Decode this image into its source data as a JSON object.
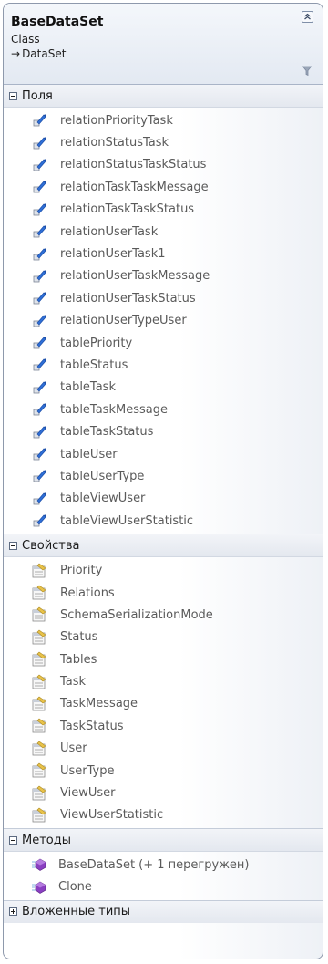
{
  "header": {
    "class_name": "BaseDataSet",
    "kind": "Class",
    "base_arrow": "→",
    "base_class": "DataSet"
  },
  "sections": {
    "fields": {
      "label": "Поля",
      "items": [
        {
          "label": "relationPriorityTask",
          "icon": "field-icon"
        },
        {
          "label": "relationStatusTask",
          "icon": "field-icon"
        },
        {
          "label": "relationStatusTaskStatus",
          "icon": "field-icon"
        },
        {
          "label": "relationTaskTaskMessage",
          "icon": "field-icon"
        },
        {
          "label": "relationTaskTaskStatus",
          "icon": "field-icon"
        },
        {
          "label": "relationUserTask",
          "icon": "field-icon"
        },
        {
          "label": "relationUserTask1",
          "icon": "field-icon"
        },
        {
          "label": "relationUserTaskMessage",
          "icon": "field-icon"
        },
        {
          "label": "relationUserTaskStatus",
          "icon": "field-icon"
        },
        {
          "label": "relationUserTypeUser",
          "icon": "field-icon"
        },
        {
          "label": "tablePriority",
          "icon": "field-icon"
        },
        {
          "label": "tableStatus",
          "icon": "field-icon"
        },
        {
          "label": "tableTask",
          "icon": "field-icon"
        },
        {
          "label": "tableTaskMessage",
          "icon": "field-icon"
        },
        {
          "label": "tableTaskStatus",
          "icon": "field-icon"
        },
        {
          "label": "tableUser",
          "icon": "field-icon"
        },
        {
          "label": "tableUserType",
          "icon": "field-icon"
        },
        {
          "label": "tableViewUser",
          "icon": "field-icon"
        },
        {
          "label": "tableViewUserStatistic",
          "icon": "field-icon"
        }
      ]
    },
    "properties": {
      "label": "Свойства",
      "items": [
        {
          "label": "Priority",
          "icon": "property-icon"
        },
        {
          "label": "Relations",
          "icon": "property-icon"
        },
        {
          "label": "SchemaSerializationMode",
          "icon": "property-icon"
        },
        {
          "label": "Status",
          "icon": "property-icon"
        },
        {
          "label": "Tables",
          "icon": "property-icon"
        },
        {
          "label": "Task",
          "icon": "property-icon"
        },
        {
          "label": "TaskMessage",
          "icon": "property-icon"
        },
        {
          "label": "TaskStatus",
          "icon": "property-icon"
        },
        {
          "label": "User",
          "icon": "property-icon"
        },
        {
          "label": "UserType",
          "icon": "property-icon"
        },
        {
          "label": "ViewUser",
          "icon": "property-icon"
        },
        {
          "label": "ViewUserStatistic",
          "icon": "property-icon"
        }
      ]
    },
    "methods": {
      "label": "Методы",
      "items": [
        {
          "label": "BaseDataSet (+ 1 перегружен)",
          "icon": "method-icon"
        },
        {
          "label": "Clone",
          "icon": "method-icon"
        }
      ]
    },
    "nested_types": {
      "label": "Вложенные типы",
      "collapsed": true
    }
  },
  "colors": {
    "border": "#8e99ac",
    "header_bg": "#e3e9f2",
    "item_text": "#5a5a5a",
    "field_icon_blue": "#2f6fd6",
    "property_icon_yellow": "#e8c24a",
    "method_icon_purple": "#8a3fc1"
  }
}
